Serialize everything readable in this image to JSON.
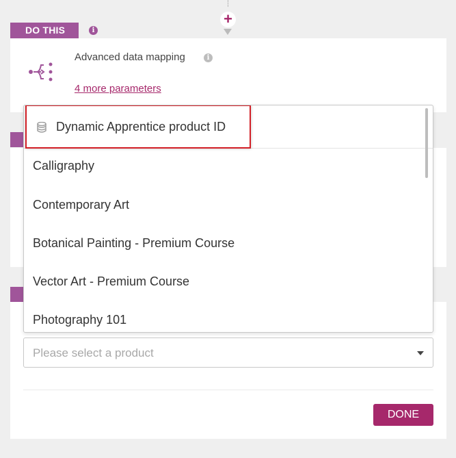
{
  "step": {
    "tag_label": "DO THIS",
    "add_symbol": "+",
    "info_symbol": "i"
  },
  "module": {
    "title": "Advanced data mapping",
    "more_parameters": "4 more parameters",
    "icon": "flow-split-icon"
  },
  "dropdown": {
    "header_label": "Dynamic Apprentice product ID",
    "header_icon": "database-icon",
    "options": [
      "Calligraphy",
      "Contemporary Art",
      "Botanical Painting - Premium Course",
      "Vector Art - Premium Course",
      "Photography 101"
    ]
  },
  "product_select": {
    "placeholder": "Please select a product"
  },
  "actions": {
    "done_label": "DONE"
  },
  "colors": {
    "accent": "#a6286b",
    "tag": "#a0559a",
    "highlight": "#d21f26"
  }
}
